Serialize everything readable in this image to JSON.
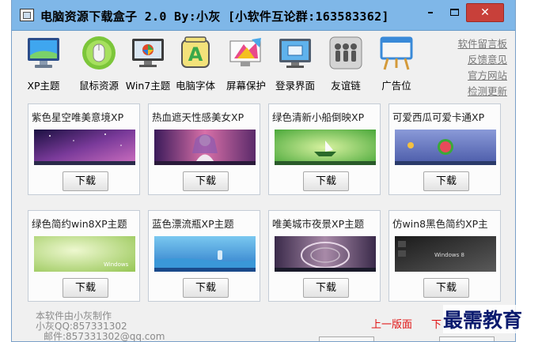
{
  "window": {
    "title": "电脑资源下载盒子 2.0 By:小灰  [小软件互论群:163583362]",
    "buttons": {
      "minimize": "–",
      "close": "✕"
    }
  },
  "toolbar": {
    "items": [
      {
        "label": "XP主题",
        "icon": "monitor-icon"
      },
      {
        "label": "鼠标资源",
        "icon": "mouse-icon"
      },
      {
        "label": "Win7主题",
        "icon": "win7-monitor-icon"
      },
      {
        "label": "电脑字体",
        "icon": "font-icon"
      },
      {
        "label": "屏幕保护",
        "icon": "screensaver-icon"
      },
      {
        "label": "登录界面",
        "icon": "login-screen-icon"
      },
      {
        "label": "友谊链",
        "icon": "people-icon"
      },
      {
        "label": "广告位",
        "icon": "billboard-icon"
      }
    ]
  },
  "side_links": [
    "软件留言板",
    "反馈意见",
    "官方网站",
    "检测更新"
  ],
  "cards": [
    {
      "title": "紫色星空唯美意境XP",
      "button": "下载",
      "thumb": "purple-starry-sky"
    },
    {
      "title": "热血遮天性感美女XP",
      "button": "下载",
      "thumb": "anime-girl"
    },
    {
      "title": "绿色清新小船倒映XP",
      "button": "下载",
      "thumb": "green-boat"
    },
    {
      "title": "可爱西瓜可爱卡通XP",
      "button": "下载",
      "thumb": "cartoon-watermelon"
    },
    {
      "title": "绿色简约win8XP主题",
      "button": "下载",
      "thumb": "green-win8"
    },
    {
      "title": "蓝色漂流瓶XP主题",
      "button": "下载",
      "thumb": "blue-bottle"
    },
    {
      "title": "唯美城市夜景XP主题",
      "button": "下载",
      "thumb": "city-night"
    },
    {
      "title": "仿win8黑色简约XP主",
      "button": "下载",
      "thumb": "black-win8"
    }
  ],
  "credits": {
    "line1": "本软件由小灰制作",
    "line2": "小灰QQ:857331302",
    "line3": "邮件:857331302@qq.com"
  },
  "pager": {
    "prev": "上一版面",
    "next": "下"
  },
  "watermark": "最需教育",
  "colors": {
    "titlebar": "#7fb7e8",
    "close_button": "#c8403a",
    "window_bg": "#f0f0f0",
    "link": "#e01010"
  }
}
